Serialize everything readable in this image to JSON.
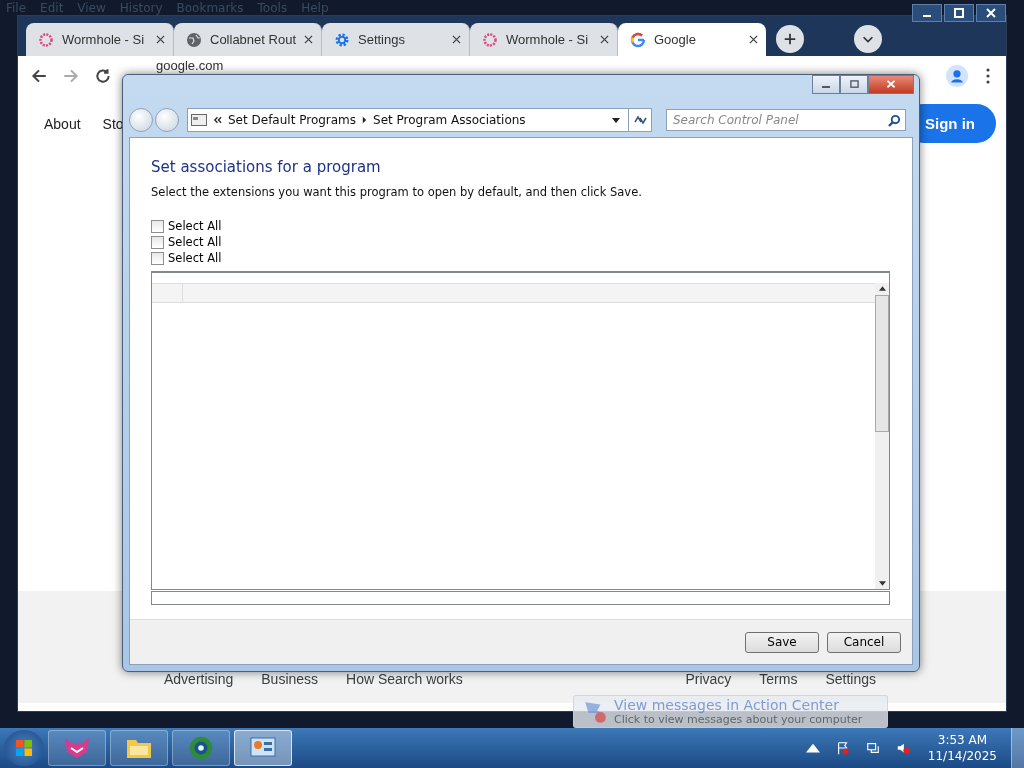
{
  "menu_bar": [
    "File",
    "Edit",
    "View",
    "History",
    "Bookmarks",
    "Tools",
    "Help"
  ],
  "tabs": [
    {
      "label": "Wormhole - Si",
      "kind": "wormhole",
      "selected": false
    },
    {
      "label": "Collabnet Rout",
      "kind": "globe",
      "selected": false
    },
    {
      "label": "Settings",
      "kind": "gear",
      "selected": false
    },
    {
      "label": "Wormhole - Si",
      "kind": "wormhole",
      "selected": false
    },
    {
      "label": "Google",
      "kind": "google",
      "selected": true
    }
  ],
  "address_bar": {
    "value": "google.com"
  },
  "page": {
    "nav_links": [
      "About",
      "Sto"
    ],
    "sign_in": "Sign in",
    "footer_left": [
      "Advertising",
      "Business",
      "How Search works"
    ],
    "footer_right": [
      "Privacy",
      "Terms",
      "Settings"
    ]
  },
  "dialog": {
    "breadcrumb": [
      "Set Default Programs",
      "Set Program Associations"
    ],
    "search": {
      "placeholder": "Search Control Panel"
    },
    "heading": "Set associations for a program",
    "instruction": "Select the extensions you want this program to open by default, and then click Save.",
    "checkboxes": [
      {
        "label": "Select All",
        "checked": false
      },
      {
        "label": "Select All",
        "checked": false
      },
      {
        "label": "Select All",
        "checked": false
      }
    ],
    "buttons": [
      "Save",
      "Cancel"
    ]
  },
  "notification": {
    "title": "View messages in Action Center",
    "text": "Click to view messages about your computer"
  },
  "taskbar": {
    "apps": [
      {
        "kind": "fox",
        "selected": false
      },
      {
        "kind": "folder",
        "selected": false
      },
      {
        "kind": "globe",
        "selected": false
      },
      {
        "kind": "control",
        "selected": true
      }
    ],
    "time": "3:53 AM",
    "date": "11/14/2025"
  }
}
